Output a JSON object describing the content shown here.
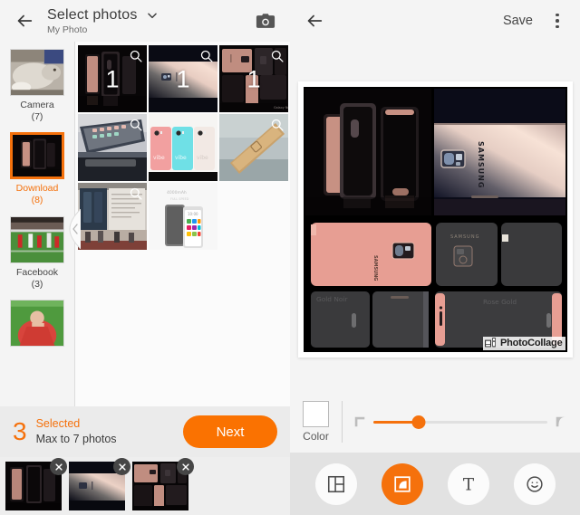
{
  "left": {
    "header": {
      "back_icon": "back-arrow-icon",
      "title": "Select photos",
      "subtitle": "My Photo",
      "dropdown_icon": "chevron-down-icon",
      "camera_icon": "camera-icon"
    },
    "albums": [
      {
        "name": "Camera",
        "count": "(7)",
        "selected": false,
        "thumb": "cat-photo"
      },
      {
        "name": "Download",
        "count": "(8)",
        "selected": true,
        "thumb": "phones-black"
      },
      {
        "name": "Facebook",
        "count": "(3)",
        "selected": false,
        "thumb": "football-match"
      },
      {
        "name": "",
        "count": "",
        "selected": false,
        "thumb": "footballer-red"
      }
    ],
    "grid": [
      {
        "badge": "1",
        "zoom_icon": "magnify-icon",
        "art": "phones-pair-black"
      },
      {
        "badge": "1",
        "zoom_icon": "magnify-icon",
        "art": "phone-gradient-rose"
      },
      {
        "badge": "1",
        "zoom_icon": "magnify-icon",
        "art": "collage-rose-grid"
      },
      {
        "badge": "",
        "zoom_icon": "magnify-icon",
        "art": "phone-icons-blur"
      },
      {
        "badge": "",
        "zoom_icon": "",
        "art": "vibe-three-phones"
      },
      {
        "badge": "",
        "zoom_icon": "magnify-icon",
        "art": "gold-phone-hand"
      },
      {
        "badge": "",
        "zoom_icon": "magnify-icon",
        "art": "presentation-stage"
      },
      {
        "badge": "",
        "zoom_icon": "",
        "art": "grey-phone-white"
      }
    ],
    "selection": {
      "count": "3",
      "label": "Selected",
      "max_text": "Max to 7 photos",
      "next_label": "Next"
    },
    "selected_thumbs": [
      {
        "art": "phones-pair-black",
        "remove_icon": "close-icon"
      },
      {
        "art": "phone-gradient-rose",
        "remove_icon": "close-icon"
      },
      {
        "art": "collage-rose-grid",
        "remove_icon": "close-icon"
      }
    ]
  },
  "right": {
    "header": {
      "back_icon": "back-arrow-icon",
      "save_label": "Save",
      "overflow_icon": "kebab-menu-icon"
    },
    "collage": {
      "watermark_text": "PhotoCollage",
      "watermark_icon": "photocollage-logo-icon",
      "captions": {
        "gold_noir": "Gold Noir",
        "rose_gold": "Rose Gold"
      }
    },
    "controls": {
      "color_label": "Color",
      "color_swatch_hex": "#FFFFFF",
      "corner_left_icon": "corner-square-icon",
      "corner_right_icon": "corner-round-icon",
      "slider_value": 26,
      "slider_min": 0,
      "slider_max": 100
    },
    "tools": [
      {
        "name": "layout",
        "icon": "layout-grid-icon",
        "active": false
      },
      {
        "name": "border",
        "icon": "frame-border-icon",
        "active": true
      },
      {
        "name": "text",
        "icon": "text-T-icon",
        "active": false
      },
      {
        "name": "sticker",
        "icon": "smiley-face-icon",
        "active": false
      }
    ]
  },
  "theme": {
    "accent": "#F5710C",
    "accent_button": "#FA7201",
    "panel_bg": "#F4F4F4",
    "footer_bg": "#EBEBEB",
    "tools_bg": "#E2E2E2"
  }
}
